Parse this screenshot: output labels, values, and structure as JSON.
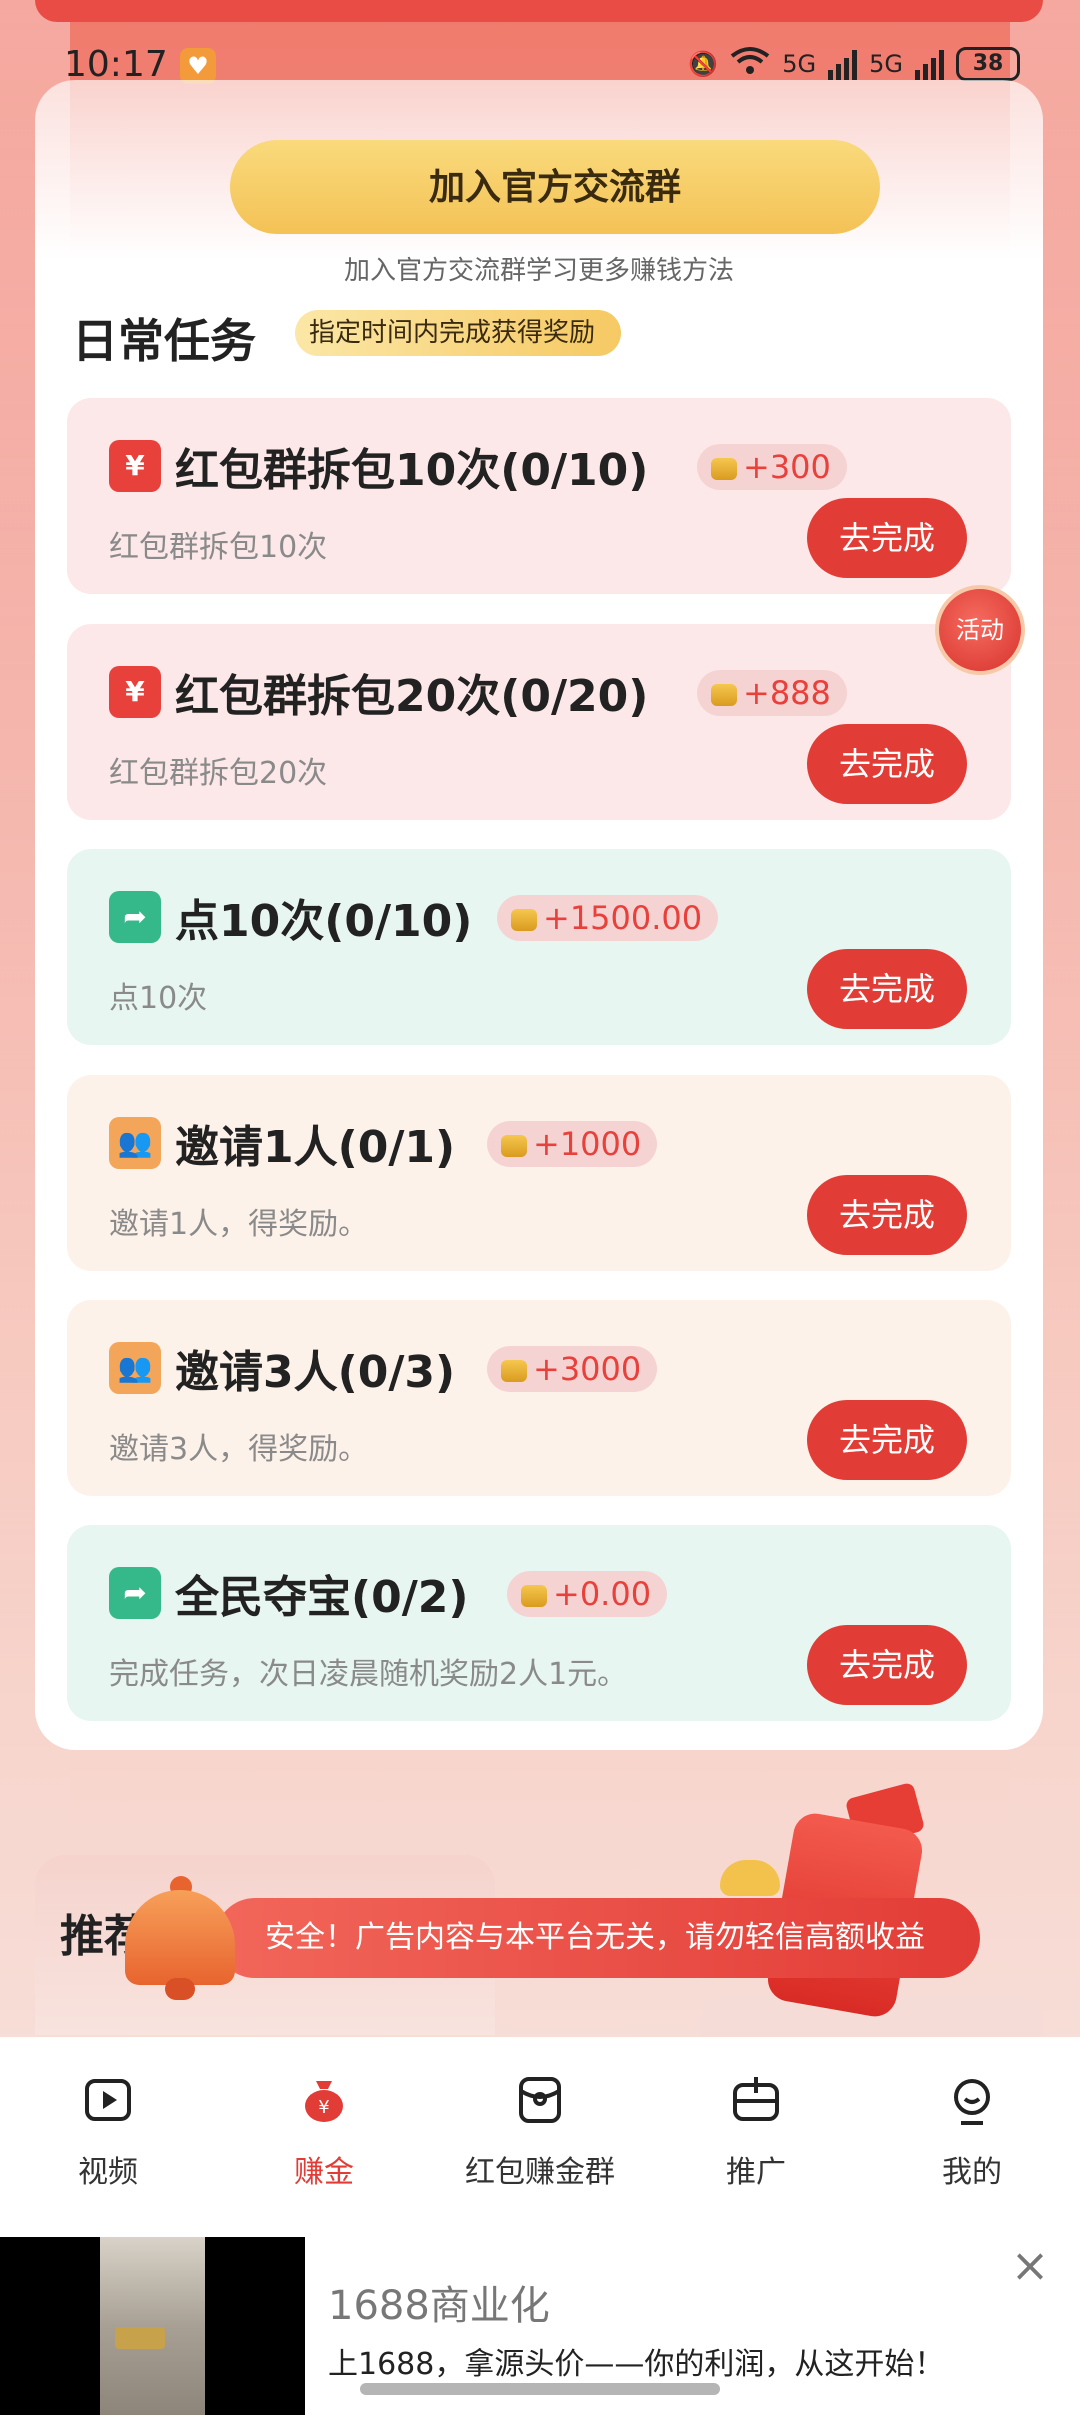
{
  "status_bar": {
    "time": "10:17",
    "battery": "38",
    "net1": "5G",
    "net2": "5G"
  },
  "header": {
    "join_button": "加入官方交流群",
    "join_desc": "加入官方交流群学习更多赚钱方法"
  },
  "daily": {
    "title": "日常任务",
    "badge": "指定时间内完成获得奖励",
    "tasks": [
      {
        "icon": "¥",
        "title": "红包群拆包10次(0/10)",
        "reward": "+300",
        "desc": "红包群拆包10次",
        "button": "去完成"
      },
      {
        "icon": "¥",
        "title": "红包群拆包20次(0/20)",
        "reward": "+888",
        "desc": "红包群拆包20次",
        "button": "去完成"
      },
      {
        "icon": "➦",
        "title": "点10次(0/10)",
        "reward": "+1500.00",
        "desc": "点10次",
        "button": "去完成"
      },
      {
        "icon": "👥",
        "title": "邀请1人(0/1)",
        "reward": "+1000",
        "desc": "邀请1人，得奖励。",
        "button": "去完成"
      },
      {
        "icon": "👥",
        "title": "邀请3人(0/3)",
        "reward": "+3000",
        "desc": "邀请3人，得奖励。",
        "button": "去完成"
      },
      {
        "icon": "➦",
        "title": "全民夺宝(0/2)",
        "reward": "+0.00",
        "desc": "完成任务，次日凌晨随机奖励2人1元。",
        "button": "去完成"
      }
    ],
    "activity_badge": "活动"
  },
  "recommend": {
    "title": "推荐",
    "marquee": "安全！广告内容与本平台无关，请勿轻信高额收益"
  },
  "tab_bar": {
    "tabs": [
      {
        "label": "视频"
      },
      {
        "label": "赚金"
      },
      {
        "label": "红包赚金群"
      },
      {
        "label": "推广"
      },
      {
        "label": "我的"
      }
    ]
  },
  "ad": {
    "title": "1688商业化",
    "desc": "上1688，拿源头价——你的利润，从这开始！",
    "close": "×"
  },
  "colors": {
    "accent": "#e23c36",
    "gold": "#f4c256"
  }
}
